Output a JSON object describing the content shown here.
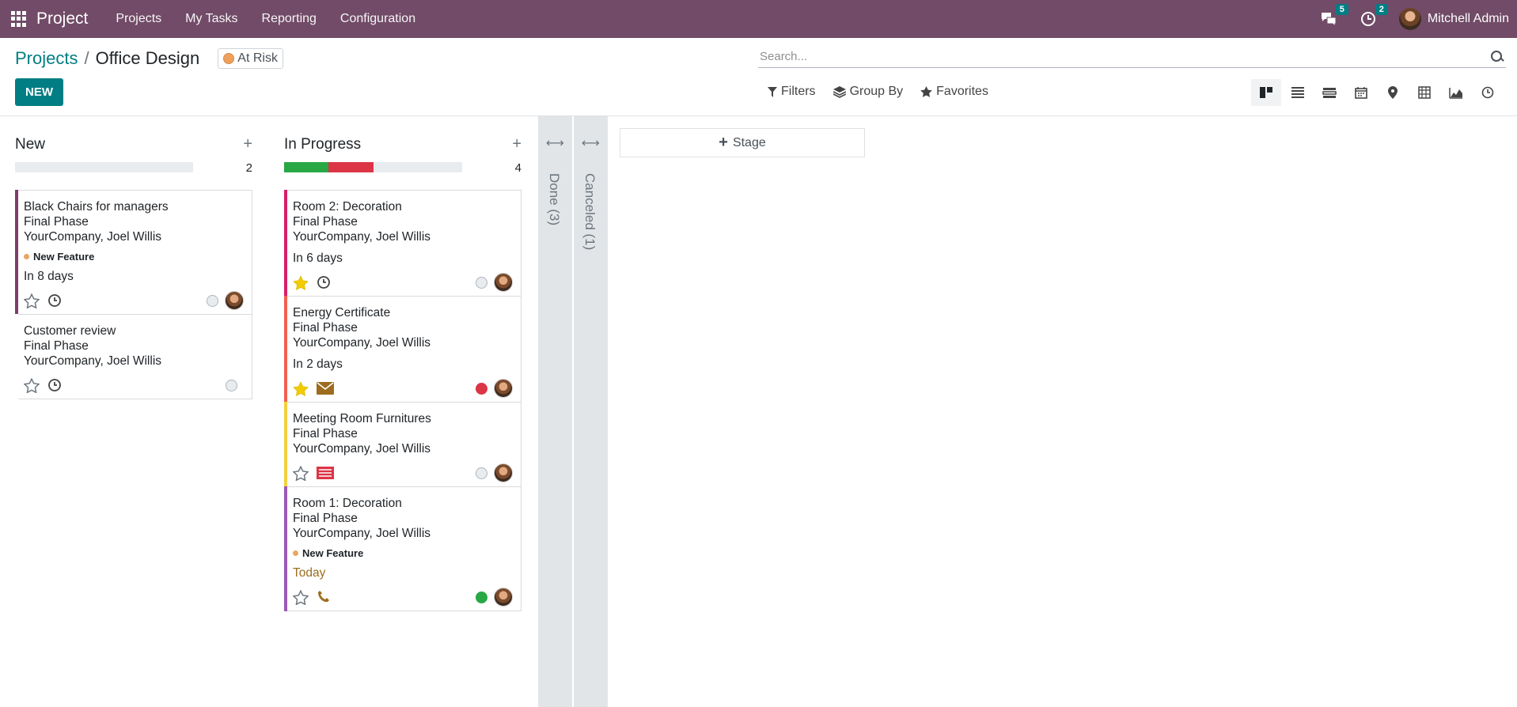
{
  "navbar": {
    "brand": "Project",
    "menu": [
      "Projects",
      "My Tasks",
      "Reporting",
      "Configuration"
    ],
    "messages_count": "5",
    "activities_count": "2",
    "user_name": "Mitchell Admin"
  },
  "control": {
    "breadcrumb_parent": "Projects",
    "breadcrumb_current": "Office Design",
    "status_label": "At Risk",
    "new_label": "NEW",
    "search_placeholder": "Search...",
    "filters_label": "Filters",
    "groupby_label": "Group By",
    "favorites_label": "Favorites"
  },
  "views": [
    "kanban-icon",
    "list-icon",
    "gantt-icon",
    "calendar-icon",
    "map-pin-icon",
    "pivot-icon",
    "graph-icon",
    "activity-icon"
  ],
  "columns": [
    {
      "title": "New",
      "count": "2",
      "progress": {
        "green": 0,
        "red": 0
      },
      "cards": [
        {
          "title": "Black Chairs for managers",
          "stage": "Final Phase",
          "company": "YourCompany, Joel Willis",
          "tag": "New Feature",
          "date": "In 8 days",
          "color": "#7f3e6a",
          "starred": false,
          "activity": "clock",
          "state": "grey"
        },
        {
          "title": "Customer review",
          "stage": "Final Phase",
          "company": "YourCompany, Joel Willis",
          "tag": "",
          "date": "",
          "color": "#ffffff",
          "starred": false,
          "activity": "clock",
          "state": "grey"
        }
      ]
    },
    {
      "title": "In Progress",
      "count": "4",
      "progress": {
        "green": 0.25,
        "red": 0.25
      },
      "cards": [
        {
          "title": "Room 2: Decoration",
          "stage": "Final Phase",
          "company": "YourCompany, Joel Willis",
          "tag": "",
          "date": "In 6 days",
          "color": "#d61f69",
          "starred": true,
          "activity": "clock",
          "state": "grey"
        },
        {
          "title": "Energy Certificate",
          "stage": "Final Phase",
          "company": "YourCompany, Joel Willis",
          "tag": "",
          "date": "In 2 days",
          "color": "#f06050",
          "starred": true,
          "activity": "envelope",
          "state": "red"
        },
        {
          "title": "Meeting Room Furnitures",
          "stage": "Final Phase",
          "company": "YourCompany, Joel Willis",
          "tag": "",
          "date": "",
          "color": "#f4d03f",
          "starred": false,
          "activity": "list",
          "state": "grey"
        },
        {
          "title": "Room 1: Decoration",
          "stage": "Final Phase",
          "company": "YourCompany, Joel Willis",
          "tag": "New Feature",
          "date": "Today",
          "color": "#9b59b6",
          "starred": false,
          "activity": "phone",
          "state": "green"
        }
      ]
    }
  ],
  "folded": [
    {
      "label": "Done (3)"
    },
    {
      "label": "Canceled (1)"
    }
  ],
  "stage_button_label": "Stage"
}
